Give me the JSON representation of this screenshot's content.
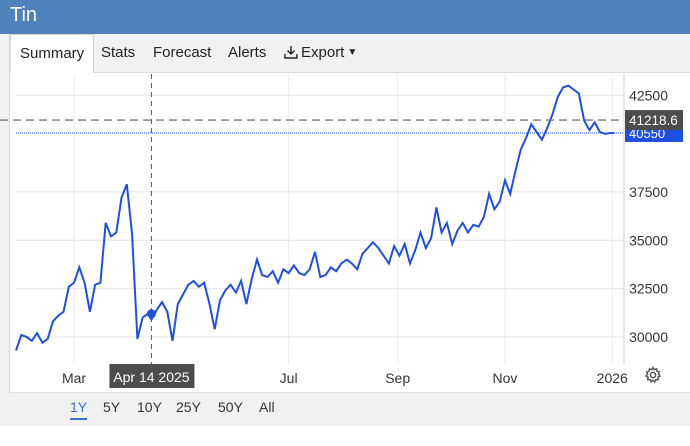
{
  "window": {
    "title": "Tin"
  },
  "tabs": [
    {
      "label": "Summary",
      "active": true
    },
    {
      "label": "Stats"
    },
    {
      "label": "Forecast"
    },
    {
      "label": "Alerts"
    },
    {
      "label": "Export"
    }
  ],
  "ranges": [
    {
      "label": "1Y",
      "active": true
    },
    {
      "label": "5Y"
    },
    {
      "label": "10Y"
    },
    {
      "label": "25Y"
    },
    {
      "label": "50Y"
    },
    {
      "label": "All"
    }
  ],
  "colors": {
    "line": "#1f4fe0",
    "header": "#4f81bd",
    "crosshair_label": "#4d4d4d",
    "last_price_label": "#1f4fe0"
  },
  "chart_data": {
    "type": "line",
    "x_tick_labels": [
      "Mar",
      "Apr 14 2025",
      "Jul",
      "Sep",
      "Nov",
      "2026"
    ],
    "y_tick_labels": [
      "30000",
      "32500",
      "35000",
      "37500",
      "42500"
    ],
    "ylim": [
      28600,
      43600
    ],
    "crosshair": {
      "x": "Apr 14 2025",
      "y": 41218.6,
      "y_label": "41218.6",
      "point_value": 31200
    },
    "last_price": {
      "value": 40550,
      "label": "40550"
    },
    "grid": true,
    "legend": "none",
    "series": [
      {
        "x": [
          "2025-01-27",
          "2025-01-30",
          "2025-02-02",
          "2025-02-05",
          "2025-02-08",
          "2025-02-11",
          "2025-02-14",
          "2025-02-17",
          "2025-02-20",
          "2025-02-23",
          "2025-02-26",
          "2025-03-01",
          "2025-03-04",
          "2025-03-07",
          "2025-03-10",
          "2025-03-13",
          "2025-03-16",
          "2025-03-19",
          "2025-03-22",
          "2025-03-25",
          "2025-03-28",
          "2025-03-31",
          "2025-04-03",
          "2025-04-06",
          "2025-04-09",
          "2025-04-12",
          "2025-04-14",
          "2025-04-17",
          "2025-04-20",
          "2025-04-23",
          "2025-04-26",
          "2025-04-29",
          "2025-05-02",
          "2025-05-05",
          "2025-05-08",
          "2025-05-11",
          "2025-05-14",
          "2025-05-17",
          "2025-05-20",
          "2025-05-23",
          "2025-05-26",
          "2025-05-29",
          "2025-06-01",
          "2025-06-04",
          "2025-06-07",
          "2025-06-10",
          "2025-06-13",
          "2025-06-16",
          "2025-06-19",
          "2025-06-22",
          "2025-06-25",
          "2025-06-28",
          "2025-07-01",
          "2025-07-04",
          "2025-07-07",
          "2025-07-10",
          "2025-07-13",
          "2025-07-16",
          "2025-07-19",
          "2025-07-22",
          "2025-07-25",
          "2025-07-28",
          "2025-07-31",
          "2025-08-03",
          "2025-08-06",
          "2025-08-09",
          "2025-08-12",
          "2025-08-15",
          "2025-08-18",
          "2025-08-21",
          "2025-08-24",
          "2025-08-27",
          "2025-08-30",
          "2025-09-02",
          "2025-09-05",
          "2025-09-08",
          "2025-09-11",
          "2025-09-14",
          "2025-09-17",
          "2025-09-20",
          "2025-09-23",
          "2025-09-26",
          "2025-09-29",
          "2025-10-02",
          "2025-10-05",
          "2025-10-08",
          "2025-10-11",
          "2025-10-14",
          "2025-10-17",
          "2025-10-20",
          "2025-10-23",
          "2025-10-26",
          "2025-10-29",
          "2025-11-01",
          "2025-11-04",
          "2025-11-07",
          "2025-11-10",
          "2025-11-13",
          "2025-11-16",
          "2025-11-19",
          "2025-11-22",
          "2025-11-25",
          "2025-11-28",
          "2025-12-01",
          "2025-12-04",
          "2025-12-07",
          "2025-12-10",
          "2025-12-13",
          "2025-12-16",
          "2025-12-19",
          "2025-12-22",
          "2025-12-25",
          "2025-12-28",
          "2025-12-31",
          "2026-01-02"
        ],
        "values": [
          29300,
          30100,
          30000,
          29800,
          30200,
          29700,
          29900,
          30800,
          31100,
          31300,
          32600,
          32800,
          33600,
          32800,
          31300,
          32700,
          32800,
          35900,
          35200,
          35400,
          37200,
          37900,
          35300,
          29900,
          31000,
          31200,
          30900,
          31400,
          31800,
          31300,
          29800,
          31700,
          32200,
          32700,
          32900,
          32600,
          32800,
          31700,
          30400,
          31900,
          32400,
          32700,
          32300,
          32900,
          31700,
          33000,
          34000,
          33200,
          33100,
          33400,
          32800,
          33500,
          33300,
          33700,
          33300,
          33200,
          33500,
          34400,
          33100,
          33200,
          33600,
          33400,
          33800,
          34000,
          33800,
          33500,
          34300,
          34600,
          34900,
          34600,
          34200,
          33800,
          34700,
          34200,
          34800,
          33800,
          34500,
          35400,
          34600,
          35100,
          36700,
          35400,
          35900,
          34800,
          35500,
          35900,
          35400,
          35800,
          35700,
          36200,
          37400,
          36600,
          37000,
          38100,
          37400,
          38600,
          39700,
          40300,
          41000,
          40600,
          40200,
          40800,
          41500,
          42400,
          42900,
          43000,
          42800,
          42600,
          41200,
          40700,
          41100,
          40600,
          40500,
          40550,
          40550
        ]
      }
    ]
  }
}
